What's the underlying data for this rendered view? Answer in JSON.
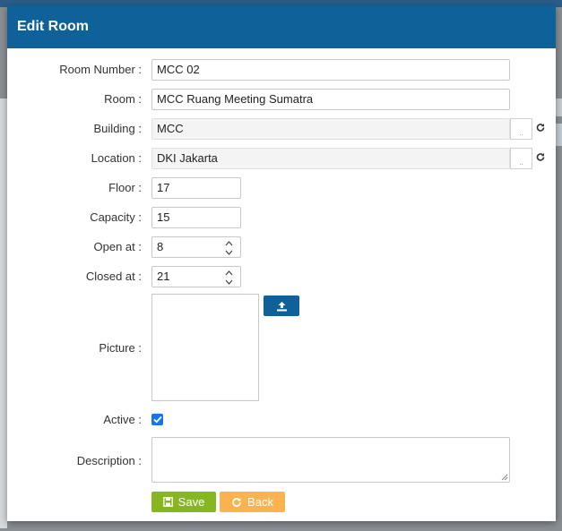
{
  "modal": {
    "title": "Edit Room"
  },
  "form": {
    "room_number": {
      "label": "Room Number :",
      "value": "MCC 02"
    },
    "room": {
      "label": "Room :",
      "value": "MCC Ruang Meeting Sumatra"
    },
    "building": {
      "label": "Building :",
      "value": "MCC",
      "select_label": ".."
    },
    "location": {
      "label": "Location :",
      "value": "DKI Jakarta",
      "select_label": ".."
    },
    "floor": {
      "label": "Floor :",
      "value": "17"
    },
    "capacity": {
      "label": "Capacity :",
      "value": "15"
    },
    "open_at": {
      "label": "Open at :",
      "value": "8"
    },
    "closed_at": {
      "label": "Closed at :",
      "value": "21"
    },
    "picture": {
      "label": "Picture :"
    },
    "active": {
      "label": "Active :",
      "checked": true
    },
    "description": {
      "label": "Description :",
      "value": ""
    }
  },
  "actions": {
    "save_label": "Save",
    "back_label": "Back"
  },
  "colors": {
    "header": "#0e6199",
    "save": "#87b720",
    "back": "#fbb34f",
    "checkbox": "#1a73e8"
  },
  "icons": {
    "refresh": "refresh-icon",
    "upload": "upload-icon",
    "save": "save-icon",
    "back": "back-icon",
    "check": "check-icon"
  }
}
